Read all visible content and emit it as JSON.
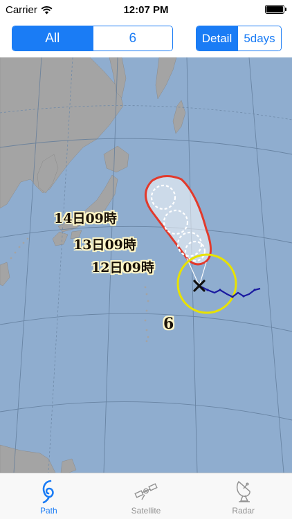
{
  "status_bar": {
    "carrier": "Carrier",
    "time": "12:07 PM"
  },
  "filter": {
    "options": [
      "All",
      "6"
    ],
    "selected": "All"
  },
  "view_mode": {
    "options": [
      "Detail",
      "5days"
    ],
    "selected": "Detail"
  },
  "map": {
    "forecast_labels": [
      "14日09時",
      "13日09時",
      "12日09時"
    ],
    "typhoon_number": "6"
  },
  "tabs": [
    {
      "label": "Path",
      "icon": "typhoon-icon",
      "active": true
    },
    {
      "label": "Satellite",
      "icon": "satellite-icon",
      "active": false
    },
    {
      "label": "Radar",
      "icon": "radar-dish-icon",
      "active": false
    }
  ],
  "colors": {
    "accent": "#1a7cf5",
    "ocean": "#8fadcf",
    "land": "#a4a4a4",
    "storm_circle": "#e8e200",
    "forecast_circle": "#e23a2c",
    "track": "#1a1aa0"
  }
}
